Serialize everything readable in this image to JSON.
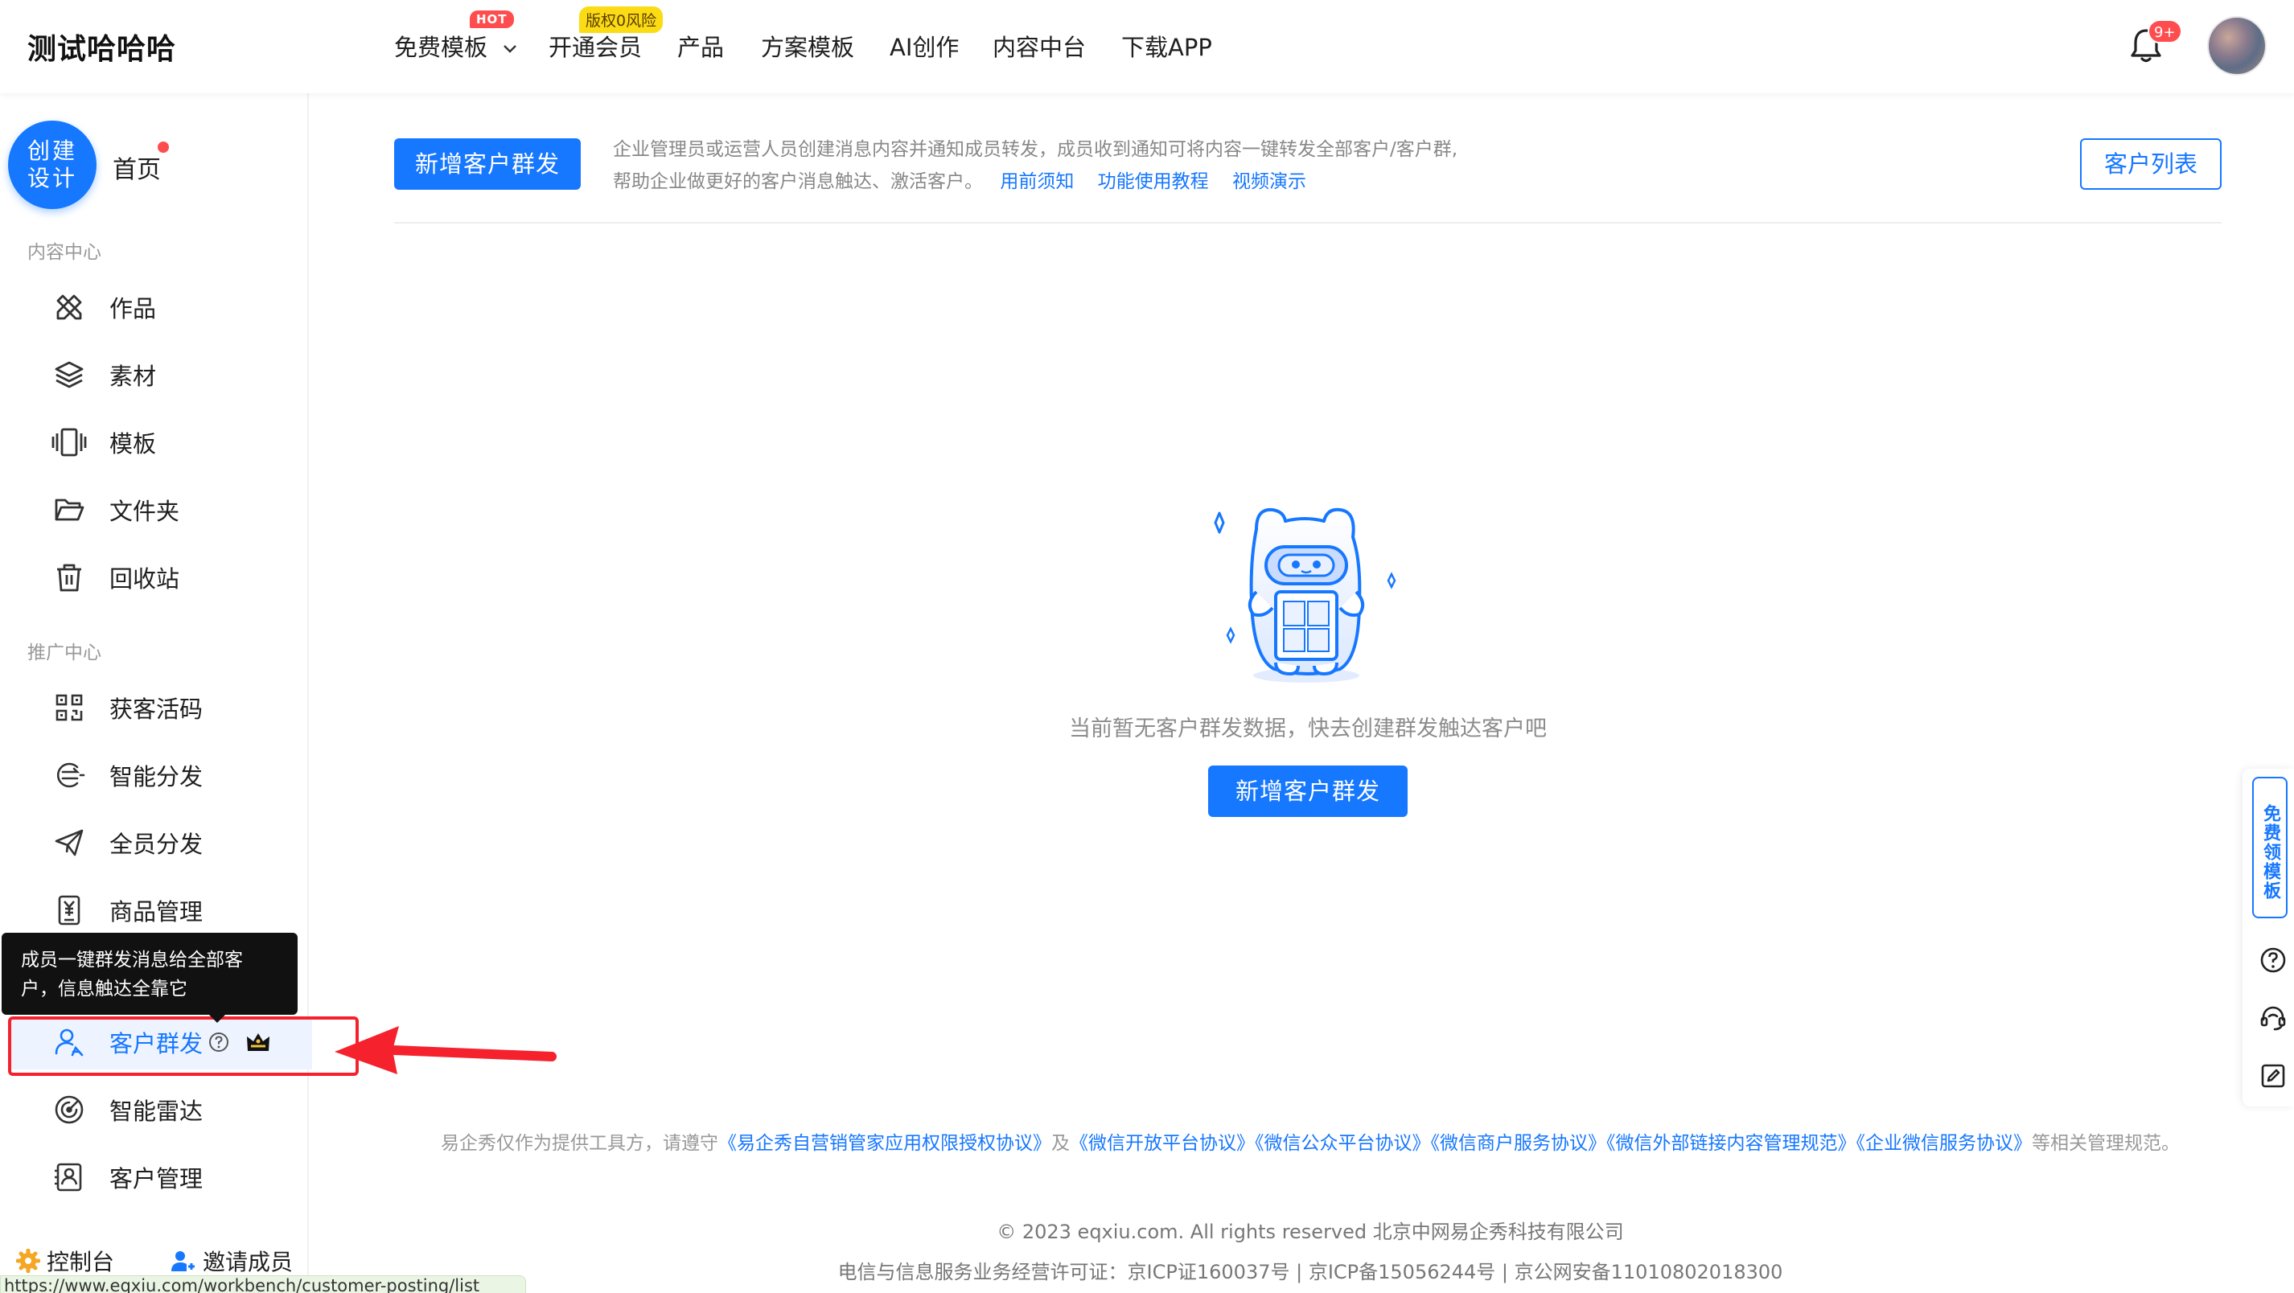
{
  "header": {
    "brand": "测试哈哈哈",
    "nav": [
      {
        "label": "免费模板",
        "badge": "HOT"
      },
      {
        "label": "开通会员",
        "badge": "版权0风险"
      },
      {
        "label": "产品"
      },
      {
        "label": "方案模板"
      },
      {
        "label": "AI创作"
      },
      {
        "label": "内容中台"
      },
      {
        "label": "下载APP"
      }
    ],
    "notification_count": "9+"
  },
  "sidebar": {
    "create_button": "创建\n设计",
    "create_line1": "创建",
    "create_line2": "设计",
    "home": "首页",
    "section_content": "内容中心",
    "content_items": [
      {
        "label": "作品",
        "icon": "works-icon"
      },
      {
        "label": "素材",
        "icon": "layers-icon"
      },
      {
        "label": "模板",
        "icon": "template-icon"
      },
      {
        "label": "文件夹",
        "icon": "folder-icon"
      },
      {
        "label": "回收站",
        "icon": "trash-icon"
      }
    ],
    "section_promo": "推广中心",
    "promo_items": [
      {
        "label": "获客活码",
        "icon": "qrcode-icon"
      },
      {
        "label": "智能分发",
        "icon": "smart-distribute-icon"
      },
      {
        "label": "全员分发",
        "icon": "send-icon"
      },
      {
        "label": "商品管理",
        "icon": "product-icon"
      },
      {
        "label": "客户群发",
        "icon": "user-broadcast-icon"
      },
      {
        "label": "智能雷达",
        "icon": "radar-icon"
      },
      {
        "label": "客户管理",
        "icon": "customer-icon"
      }
    ],
    "tooltip": "成员一键群发消息给全部客户，信息触达全靠它",
    "bottom": {
      "console": "控制台",
      "invite": "邀请成员"
    }
  },
  "status_url": "https://www.eqxiu.com/workbench/customer-posting/list",
  "main": {
    "add_button": "新增客户群发",
    "description_line1": "企业管理员或运营人员创建消息内容并通知成员转发，成员收到通知可将内容一键转发全部客户/客户群,",
    "description_line2": "帮助企业做更好的客户消息触达、激活客户。",
    "links": [
      "用前须知",
      "功能使用教程",
      "视频演示"
    ],
    "customer_list_button": "客户列表",
    "empty_text": "当前暂无客户群发数据，快去创建群发触达客户吧",
    "empty_add_button": "新增客户群发"
  },
  "footer": {
    "notice_prefix": "易企秀仅作为提供工具方，请遵守",
    "agreements": [
      "《易企秀自营销管家应用权限授权协议》",
      "及",
      "《微信开放平台协议》",
      "《微信公众平台协议》",
      "《微信商户服务协议》",
      "《微信外部链接内容管理规范》",
      "《企业微信服务协议》"
    ],
    "notice_suffix": "等相关管理规范。",
    "copyright": "© 2023 eqxiu.com. All rights reserved 北京中网易企秀科技有限公司",
    "license": "电信与信息服务业务经营许可证：京ICP证160037号 | 京ICP备15056244号 | 京公网安备11010802018300"
  },
  "float_tools": {
    "free_template": "免费领模板"
  },
  "colors": {
    "primary": "#1677ff",
    "alert": "#ff4d4f",
    "highlight": "#f5222d"
  }
}
